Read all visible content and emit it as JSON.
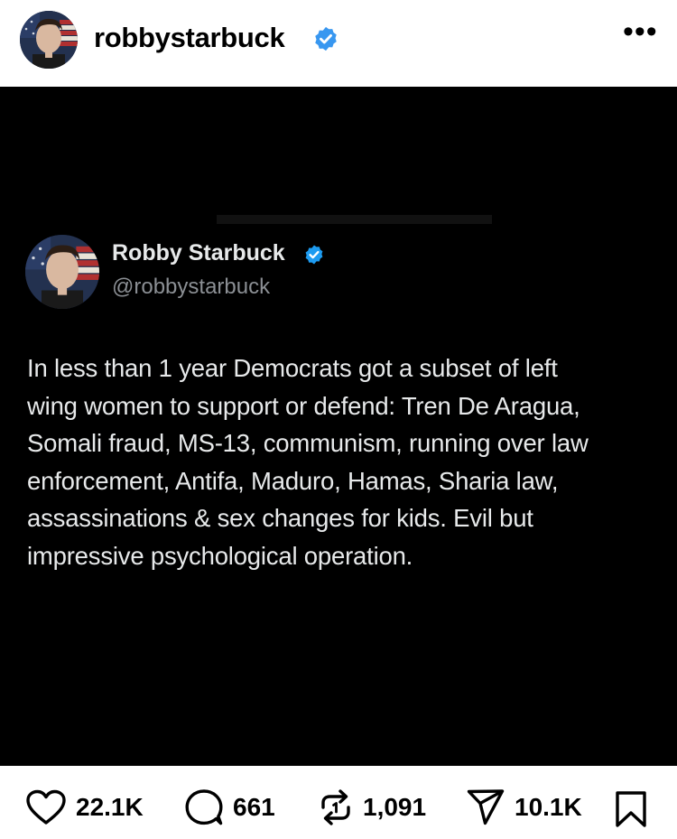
{
  "header": {
    "username": "robbystarbuck",
    "more_label": "•••"
  },
  "post": {
    "author_name": "Robby Starbuck",
    "author_handle": "@robbystarbuck",
    "lines": [
      "In less than 1 year Democrats got a subset of left",
      "wing women to support or defend: Tren De Aragua,",
      "Somali fraud, MS-13, communism, running over law",
      "enforcement, Antifa, Maduro, Hamas, Sharia law,",
      "assassinations & sex changes for kids. Evil but",
      "impressive psychological operation."
    ]
  },
  "actions": {
    "likes": "22.1K",
    "comments": "661",
    "reposts": "1,091",
    "shares": "10.1K"
  },
  "colors": {
    "verified": "#3897f0",
    "post_background": "#000000",
    "post_text": "#e7e9ea",
    "handle_text": "#8b8f94"
  },
  "icons": [
    "verified-badge-icon",
    "more-options-icon",
    "heart-icon",
    "comment-icon",
    "repost-icon",
    "share-icon",
    "bookmark-icon"
  ]
}
